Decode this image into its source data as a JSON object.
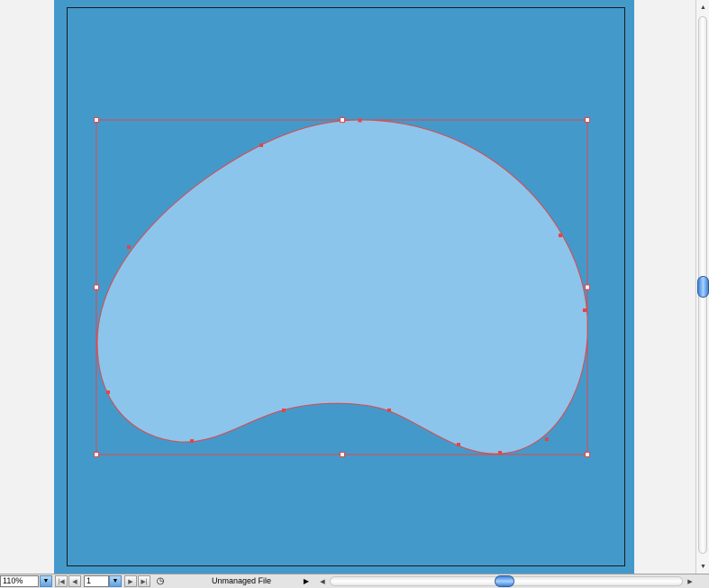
{
  "canvas": {
    "artboard_color": "#4499cb",
    "shape_fill": "#8bc5ec",
    "selection_color": "#e34646"
  },
  "statusbar": {
    "zoom_value": "110%",
    "page_value": "1",
    "status_text": "Unmanaged File",
    "icons": {
      "zoom_dropdown": "chevron-down-icon",
      "first_page": "first-page-icon",
      "prev_page": "prev-page-icon",
      "page_dropdown": "chevron-down-icon",
      "next_page": "next-page-icon",
      "last_page": "last-page-icon",
      "status_icon": "clock-icon",
      "status_menu": "triangle-right-icon"
    }
  }
}
